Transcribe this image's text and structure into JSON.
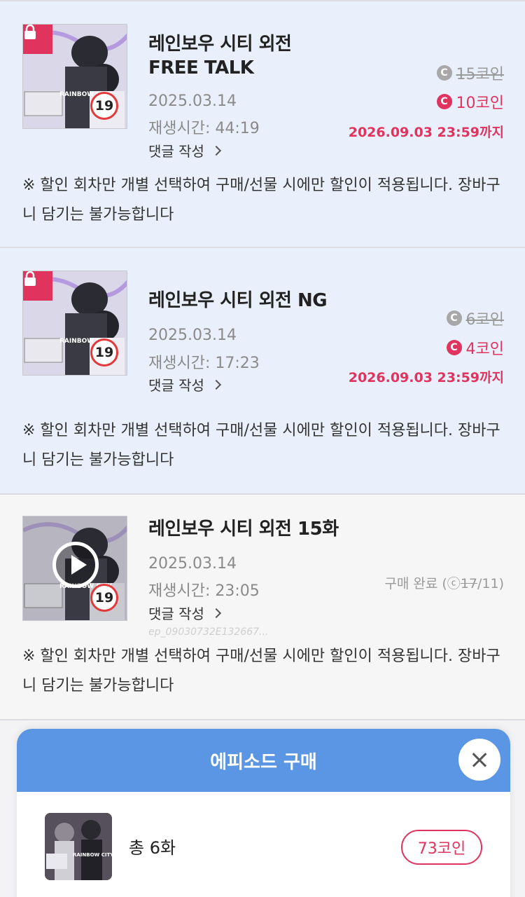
{
  "episodes": [
    {
      "title_line1": "레인보우 시티 외전",
      "title_line2": "FREE TALK",
      "date": "2025.03.14",
      "runtime": "재생시간: 44:19",
      "comment_label": "댓글 작성",
      "original_price": "15코인",
      "sale_price": "10코인",
      "deadline": "2026.09.03 23:59까지",
      "age_rating": "19",
      "thumb_text": "RAINBOW CITY",
      "notice": "※ 할인 회차만 개별 선택하여 구매/선물 시에만 할인이 적용됩니다. 장바구니 담기는 불가능합니다"
    },
    {
      "title_line1": "레인보우 시티 외전 NG",
      "date": "2025.03.14",
      "runtime": "재생시간: 17:23",
      "comment_label": "댓글 작성",
      "original_price": "6코인",
      "sale_price": "4코인",
      "deadline": "2026.09.03 23:59까지",
      "age_rating": "19",
      "thumb_text": "RAINBOW CITY",
      "notice": "※ 할인 회차만 개별 선택하여 구매/선물 시에만 할인이 적용됩니다. 장바구니 담기는 불가능합니다"
    },
    {
      "title_line1": "레인보우 시티 외전 15화",
      "date": "2025.03.14",
      "runtime": "재생시간: 23:05",
      "comment_label": "댓글 작성",
      "purchased_prefix": "구매 완료 (",
      "purchased_coin": "ⓒ",
      "purchased_strike": "17",
      "purchased_suffix": "/11)",
      "episode_id": "ep_09030732E132667...",
      "age_rating": "19",
      "thumb_text": "RAINBOW CITY",
      "notice": "※ 할인 회차만 개별 선택하여 구매/선물 시에만 할인이 적용됩니다. 장바구니 담기는 불가능합니다"
    }
  ],
  "modal": {
    "title": "에피소드 구매",
    "total_label": "총 6화",
    "total_price": "73코인",
    "thumb_text": "RAINBOW CITY"
  },
  "icons": {
    "coin_glyph": "C"
  },
  "colors": {
    "accent_pink": "#e0335e",
    "header_blue": "#5b96e4",
    "locked_bg": "#eaf0fb"
  }
}
